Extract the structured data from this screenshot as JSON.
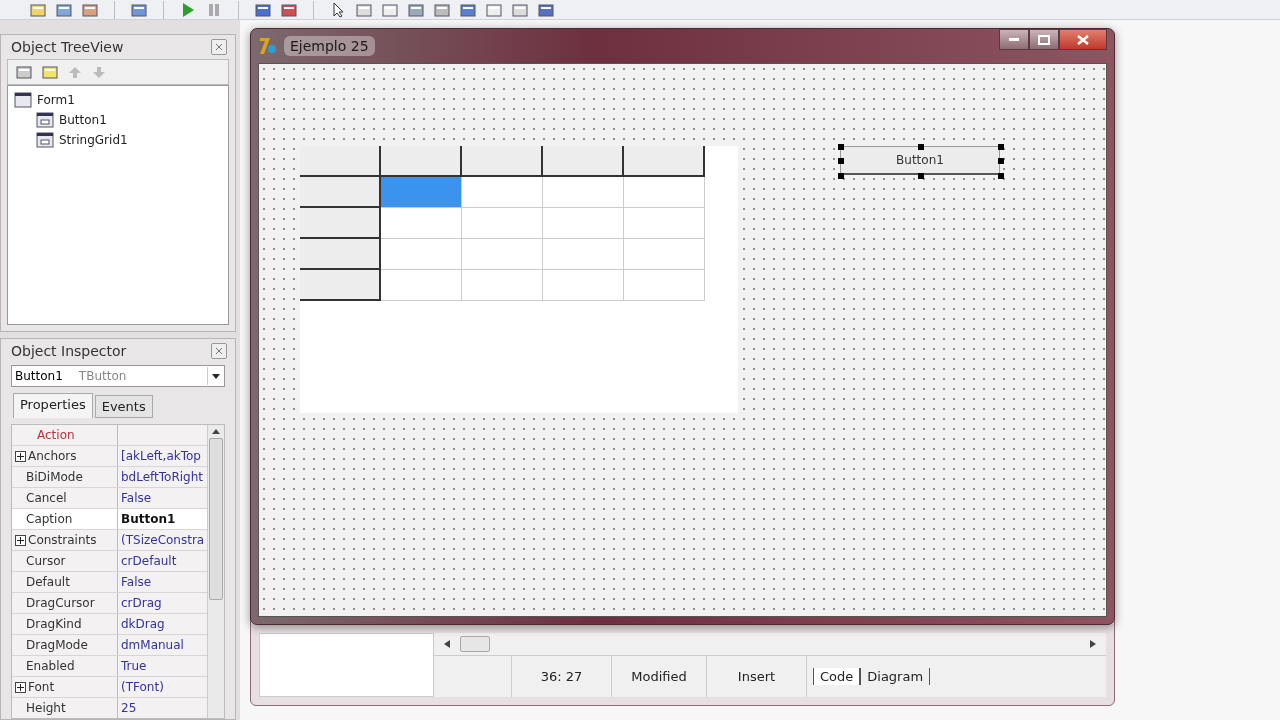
{
  "tree_view": {
    "title": "Object TreeView",
    "items": [
      {
        "label": "Form1",
        "children": [
          {
            "label": "Button1"
          },
          {
            "label": "StringGrid1"
          }
        ]
      }
    ]
  },
  "inspector": {
    "title": "Object Inspector",
    "component": "Button1",
    "component_type": "TButton",
    "tabs": [
      {
        "label": "Properties",
        "selected": true
      },
      {
        "label": "Events",
        "selected": false
      }
    ],
    "properties": [
      {
        "name": "Action",
        "kind": "reference",
        "selected": false
      },
      {
        "name": "Anchors",
        "value": "[akLeft,akTop",
        "kind": "expandable",
        "selected": false
      },
      {
        "name": "BiDiMode",
        "value": "bdLeftToRight",
        "kind": "plain",
        "selected": false
      },
      {
        "name": "Cancel",
        "value": "False",
        "kind": "plain",
        "selected": false
      },
      {
        "name": "Caption",
        "value": "Button1",
        "kind": "plain",
        "selected": true
      },
      {
        "name": "Constraints",
        "value": "(TSizeConstra",
        "kind": "expandable",
        "selected": false
      },
      {
        "name": "Cursor",
        "value": "crDefault",
        "kind": "plain",
        "selected": false
      },
      {
        "name": "Default",
        "value": "False",
        "kind": "plain",
        "selected": false
      },
      {
        "name": "DragCursor",
        "value": "crDrag",
        "kind": "plain",
        "selected": false
      },
      {
        "name": "DragKind",
        "value": "dkDrag",
        "kind": "plain",
        "selected": false
      },
      {
        "name": "DragMode",
        "value": "dmManual",
        "kind": "plain",
        "selected": false
      },
      {
        "name": "Enabled",
        "value": "True",
        "kind": "plain",
        "selected": false
      },
      {
        "name": "Font",
        "value": "(TFont)",
        "kind": "expandable",
        "selected": false
      },
      {
        "name": "Height",
        "value": "25",
        "kind": "plain",
        "selected": false
      }
    ]
  },
  "form_window": {
    "title": "Ejemplo 25",
    "grid": {
      "rows": [
        {
          "cells": [
            {
              "kind": "fixed",
              "selected": false
            },
            {
              "kind": "fixed",
              "selected": false
            },
            {
              "kind": "fixed",
              "selected": false
            },
            {
              "kind": "fixed",
              "selected": false
            },
            {
              "kind": "fixed",
              "selected": false
            }
          ]
        },
        {
          "cells": [
            {
              "kind": "fixed",
              "selected": false
            },
            {
              "kind": "cell",
              "selected": true
            },
            {
              "kind": "cell",
              "selected": false
            },
            {
              "kind": "cell",
              "selected": false
            },
            {
              "kind": "cell",
              "selected": false
            }
          ]
        },
        {
          "cells": [
            {
              "kind": "fixed",
              "selected": false
            },
            {
              "kind": "cell",
              "selected": false
            },
            {
              "kind": "cell",
              "selected": false
            },
            {
              "kind": "cell",
              "selected": false
            },
            {
              "kind": "cell",
              "selected": false
            }
          ]
        },
        {
          "cells": [
            {
              "kind": "fixed",
              "selected": false
            },
            {
              "kind": "cell",
              "selected": false
            },
            {
              "kind": "cell",
              "selected": false
            },
            {
              "kind": "cell",
              "selected": false
            },
            {
              "kind": "cell",
              "selected": false
            }
          ]
        },
        {
          "cells": [
            {
              "kind": "fixed",
              "selected": false
            },
            {
              "kind": "cell",
              "selected": false
            },
            {
              "kind": "cell",
              "selected": false
            },
            {
              "kind": "cell",
              "selected": false
            },
            {
              "kind": "cell",
              "selected": false
            }
          ]
        }
      ]
    },
    "button": {
      "caption": "Button1",
      "selected": true
    }
  },
  "editor": {
    "status": [
      "36: 27",
      "Modified",
      "Insert"
    ],
    "tabs": [
      {
        "label": "Code",
        "selected": true
      },
      {
        "label": "Diagram",
        "selected": false
      }
    ]
  }
}
